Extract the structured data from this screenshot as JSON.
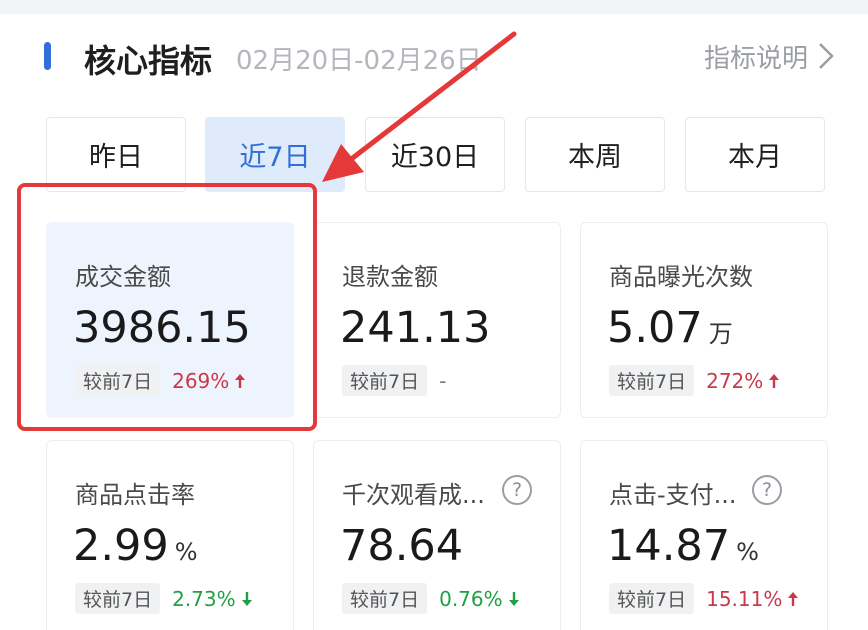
{
  "colors": {
    "accent_blue": "#2f6fd7",
    "active_tab_bg": "#dfeafb",
    "highlight_card_bg": "#eef4fd",
    "annotation_red": "#e53838",
    "up": "#c9394a",
    "down": "#1fa045"
  },
  "header": {
    "title": "核心指标",
    "date_range": "02月20日-02月26日",
    "help_link": "指标说明",
    "chevron_icon": "chevron-right-icon",
    "bar_color": "#2f6fd7"
  },
  "tabs": [
    {
      "label": "昨日",
      "active": false
    },
    {
      "label": "近7日",
      "active": true
    },
    {
      "label": "近30日",
      "active": false
    },
    {
      "label": "本周",
      "active": false
    },
    {
      "label": "本月",
      "active": false
    }
  ],
  "cards": [
    {
      "label": "成交金额",
      "value": "3986.15",
      "unit": "",
      "help": false,
      "compare_label": "较前7日",
      "change": "269%",
      "trend": "up",
      "highlight": true
    },
    {
      "label": "退款金额",
      "value": "241.13",
      "unit": "",
      "help": false,
      "compare_label": "较前7日",
      "change": "-",
      "trend": "none",
      "highlight": false
    },
    {
      "label": "商品曝光次数",
      "value": "5.07",
      "unit": "万",
      "help": false,
      "compare_label": "较前7日",
      "change": "272%",
      "trend": "up",
      "highlight": false
    },
    {
      "label": "商品点击率",
      "value": "2.99",
      "unit": "%",
      "help": false,
      "compare_label": "较前7日",
      "change": "2.73%",
      "trend": "down",
      "highlight": false
    },
    {
      "label": "千次观看成...",
      "value": "78.64",
      "unit": "",
      "help": true,
      "compare_label": "较前7日",
      "change": "0.76%",
      "trend": "down",
      "highlight": false
    },
    {
      "label": "点击-支付...",
      "value": "14.87",
      "unit": "%",
      "help": true,
      "compare_label": "较前7日",
      "change": "15.11%",
      "trend": "up",
      "highlight": false
    }
  ],
  "help_symbol": "?",
  "annotation": {
    "type": "red-arrow-and-box",
    "target": "成交金额"
  }
}
